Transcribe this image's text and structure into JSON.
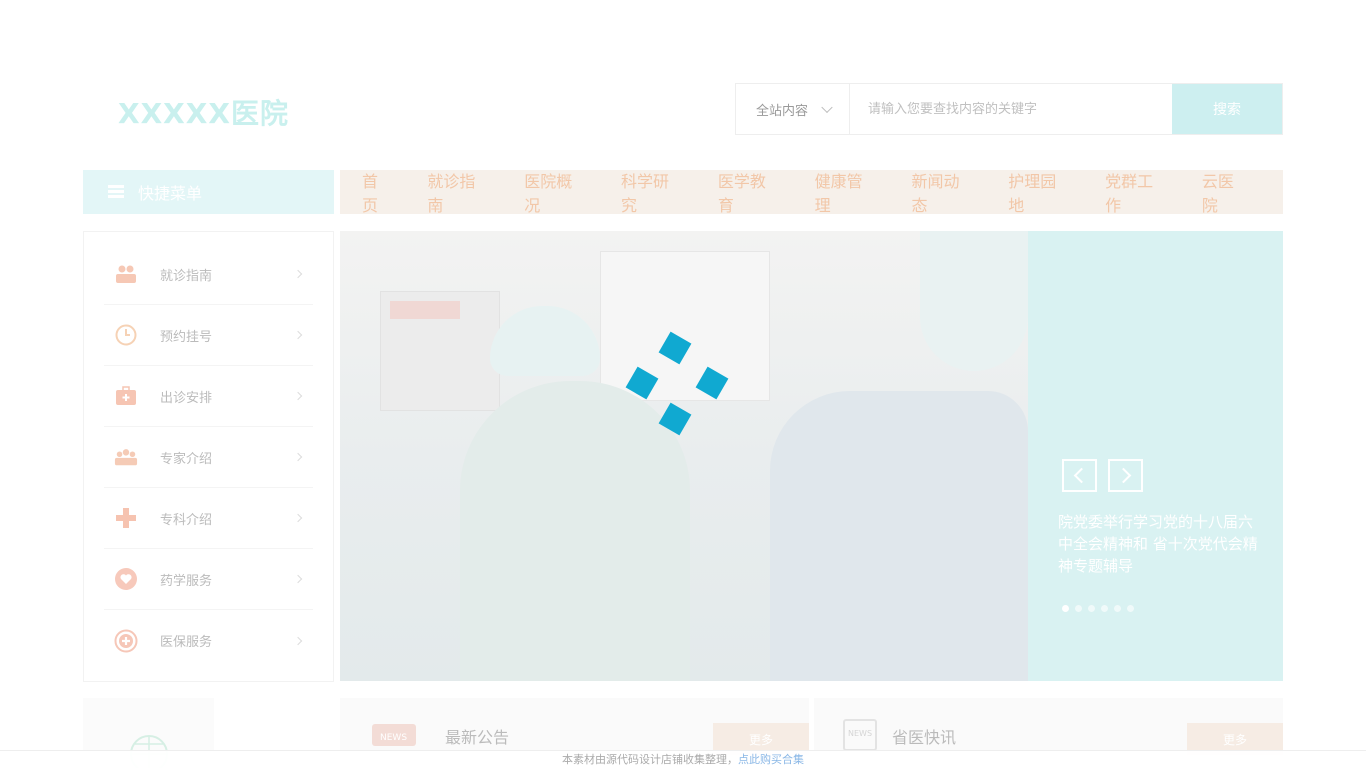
{
  "header": {
    "logo": "XXXXX医院",
    "search": {
      "scope": "全站内容",
      "placeholder": "请输入您要查找内容的关键字",
      "button": "搜索"
    }
  },
  "quick_menu": {
    "title": "快捷菜单",
    "items": [
      {
        "label": "就诊指南",
        "icon": "people-icon"
      },
      {
        "label": "预约挂号",
        "icon": "clock-icon"
      },
      {
        "label": "出诊安排",
        "icon": "medkit-icon"
      },
      {
        "label": "专家介绍",
        "icon": "group-icon"
      },
      {
        "label": "专科介绍",
        "icon": "cross-icon"
      },
      {
        "label": "药学服务",
        "icon": "heart-icon"
      },
      {
        "label": "医保服务",
        "icon": "plus-circle-icon"
      }
    ]
  },
  "nav": {
    "items": [
      "首页",
      "就诊指南",
      "医院概况",
      "科学研究",
      "医学教育",
      "健康管理",
      "新闻动态",
      "护理园地",
      "党群工作",
      "云医院"
    ]
  },
  "banner": {
    "caption": "院党委举行学习党的十八届六中全会精神和 省十次党代会精神专题辅导",
    "slide_count": 6,
    "active_slide": 1
  },
  "news_boxes": [
    {
      "title": "最新公告",
      "more": "更多"
    },
    {
      "title": "省医快讯",
      "more": "更多"
    }
  ],
  "footer": {
    "text": "本素材由源代码设计店铺收集整理，",
    "link": "点此购买合集"
  },
  "colors": {
    "accent": "#10a9d1",
    "nav_bg": "#f6f0ea",
    "nav_text": "#f2c7a8",
    "teal_light": "#d9f2f2"
  }
}
